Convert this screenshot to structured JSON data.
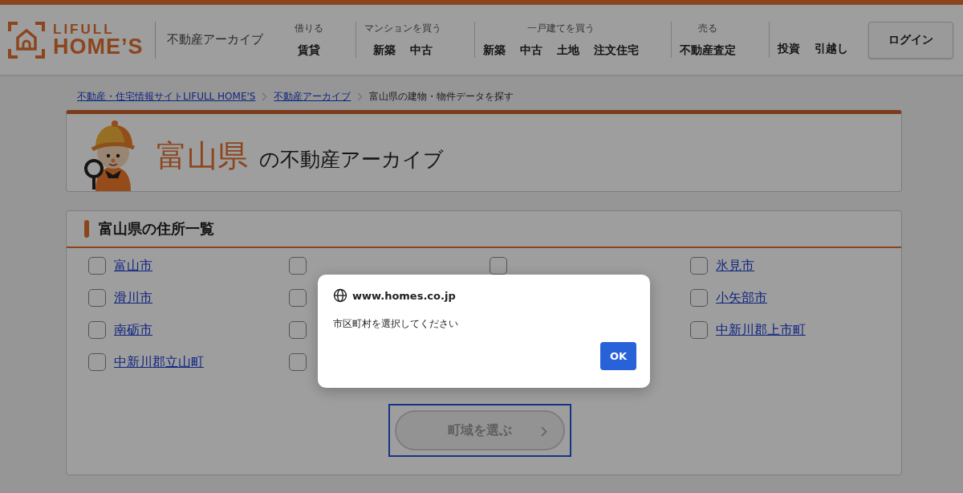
{
  "header": {
    "logo": {
      "line1": "LIFULL",
      "line2": "HOME’S"
    },
    "section_title": "不動産アーカイブ",
    "nav": [
      {
        "heading": "借りる",
        "links": [
          "賃貸"
        ]
      },
      {
        "heading": "マンションを買う",
        "links": [
          "新築",
          "中古"
        ]
      },
      {
        "heading": "一戸建てを買う",
        "links": [
          "新築",
          "中古",
          "土地",
          "注文住宅"
        ]
      },
      {
        "heading": "売る",
        "links": [
          "不動産査定"
        ]
      },
      {
        "links": [
          "投資",
          "引越し"
        ]
      }
    ],
    "login_button": "ログイン"
  },
  "breadcrumb": [
    {
      "label": "不動産・住宅情報サイトLIFULL HOME'S",
      "kind": "link"
    },
    {
      "label": "不動産アーカイブ",
      "kind": "link"
    },
    {
      "label": "富山県の建物・物件データを探す",
      "kind": "current"
    }
  ],
  "title_card": {
    "prefecture": "富山県",
    "suffix": "の不動産アーカイブ"
  },
  "address_list": {
    "heading": "富山県の住所一覧",
    "items": [
      {
        "kind": "link",
        "label": "富山市",
        "checked": false
      },
      {
        "kind": "checkbox",
        "checked": false
      },
      {
        "kind": "checkbox",
        "checked": false
      },
      {
        "kind": "link",
        "label": "氷見市",
        "checked": false
      },
      {
        "kind": "link",
        "label": "滑川市",
        "checked": false
      },
      {
        "kind": "checkbox",
        "checked": false
      },
      {
        "kind": "covered"
      },
      {
        "kind": "link",
        "label": "小矢部市",
        "checked": false
      },
      {
        "kind": "link",
        "label": "南砺市",
        "checked": false
      },
      {
        "kind": "checkbox",
        "checked": false
      },
      {
        "kind": "covered"
      },
      {
        "kind": "link",
        "label": "中新川郡上市町",
        "checked": false
      },
      {
        "kind": "link",
        "label": "中新川郡立山町",
        "checked": false
      },
      {
        "kind": "checkbox",
        "checked": false
      }
    ],
    "submit_button": {
      "label": "町域を選ぶ",
      "disabled": true,
      "focused": true
    }
  },
  "dialog": {
    "site": "www.homes.co.jp",
    "message": "市区町村を選択してください",
    "ok_button": "OK"
  }
}
